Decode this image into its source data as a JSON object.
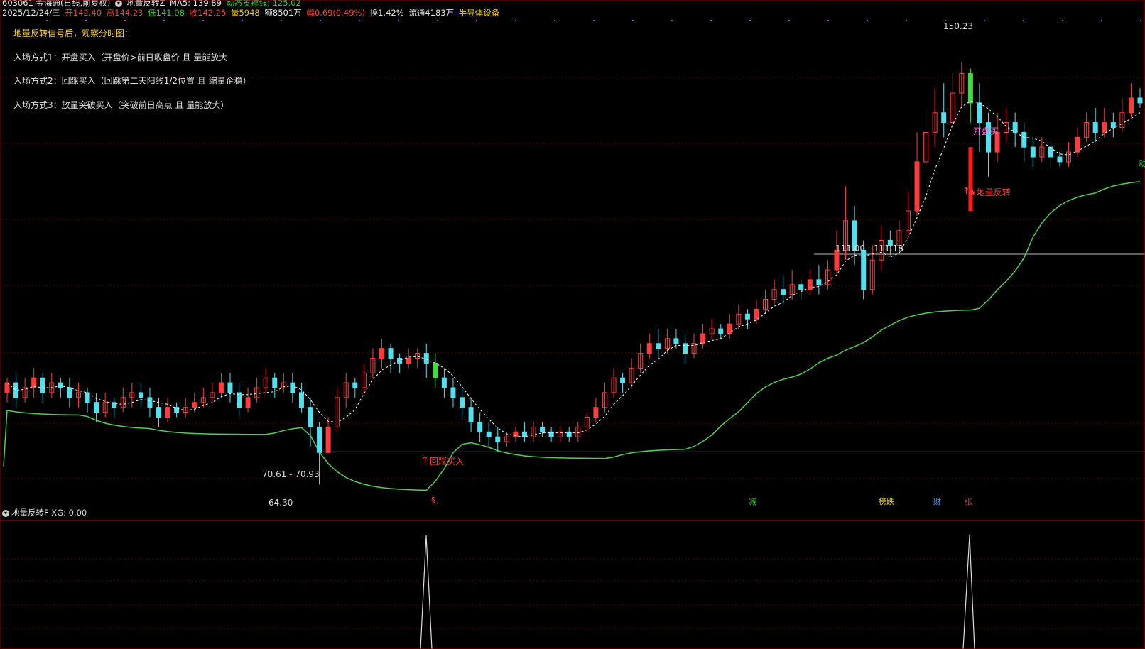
{
  "header": {
    "stock": "603061 金海通(日线,前复权)",
    "indicator": "地量反转Z",
    "ma5": "MA5: 139.89",
    "support": "动态支撑线: 125.02",
    "date": "2025/12/24/三",
    "open": "开142.40",
    "high": "高144.23",
    "low": "低141.08",
    "close": "收142.25",
    "vol": "量5948",
    "amount": "额8501万",
    "change": "幅0.69(0.49%)",
    "turnover": "换1.42%",
    "float": "流通4183万",
    "sector": "半导体设备"
  },
  "tips": {
    "title": "地量反转信号后，观察分时图：",
    "line1": "入场方式1：开盘买入（开盘价>前日收盘价 且 量能放大",
    "line2": "入场方式2：回踩买入（回踩第二天阳线1/2位置 且 缩量企稳）",
    "line3": "入场方式3：放量突破买入（突破前日高点 且 量能放大）"
  },
  "annotations": {
    "high_label": "150.23",
    "low_label": "64.30",
    "zone1": "70.61 - 70.93",
    "zone2": "111.00 - 111.18",
    "sig_pullback": "回踩买入",
    "sig_open": "开盘买",
    "sig_reverse": "★地量反转",
    "edge_label": "动"
  },
  "events": [
    {
      "label": "§",
      "color": "#ff3b3b"
    },
    {
      "label": "减",
      "color": "#2ecc40"
    },
    {
      "label": "榜跌",
      "color": "#f5d000"
    },
    {
      "label": "财",
      "color": "#4aa3ff"
    },
    {
      "label": "张",
      "color": "#ff3b3b"
    }
  ],
  "sub": {
    "title": "地量反转F",
    "xg": "XG: 0.00"
  },
  "colors": {
    "up": "#ff3b3b",
    "down": "#52e0ee",
    "signal": "#38e038",
    "support": "#4fd14f",
    "ma5": "#ffffff",
    "grid": "#5a0000"
  },
  "chart_data": {
    "type": "candlestick",
    "ylim": [
      60,
      155
    ],
    "key_prices": {
      "peak": 150.23,
      "bottom": 64.3,
      "zone1_low": 70.61,
      "zone1_high": 70.93,
      "zone2_low": 111.0,
      "zone2_high": 111.18
    },
    "candles": [
      [
        83,
        85,
        81,
        86
      ],
      [
        85,
        82,
        80,
        87
      ],
      [
        82,
        84,
        81,
        86
      ],
      [
        84,
        86,
        82,
        88
      ],
      [
        86,
        83,
        81,
        87
      ],
      [
        83,
        85,
        82,
        87
      ],
      [
        85,
        84,
        82,
        86
      ],
      [
        84,
        82,
        80,
        86
      ],
      [
        82,
        83,
        80,
        85
      ],
      [
        83,
        81,
        79,
        84
      ],
      [
        81,
        79,
        77,
        83
      ],
      [
        79,
        81,
        78,
        83
      ],
      [
        81,
        80,
        78,
        82
      ],
      [
        80,
        82,
        79,
        84
      ],
      [
        82,
        83,
        80,
        85
      ],
      [
        83,
        82,
        80,
        85
      ],
      [
        82,
        80,
        78,
        84
      ],
      [
        80,
        78,
        76,
        82
      ],
      [
        78,
        80,
        77,
        82
      ],
      [
        80,
        79,
        78,
        81
      ],
      [
        79,
        80,
        78,
        82
      ],
      [
        80,
        81,
        79,
        83
      ],
      [
        81,
        82,
        80,
        84
      ],
      [
        82,
        83,
        81,
        85
      ],
      [
        83,
        85,
        82,
        87
      ],
      [
        85,
        83,
        81,
        87
      ],
      [
        83,
        80,
        78,
        85
      ],
      [
        80,
        82,
        79,
        84
      ],
      [
        82,
        84,
        81,
        86
      ],
      [
        84,
        86,
        83,
        88
      ],
      [
        86,
        84,
        82,
        87
      ],
      [
        84,
        85,
        83,
        87
      ],
      [
        85,
        83,
        81,
        87
      ],
      [
        83,
        80,
        79,
        85
      ],
      [
        80,
        76,
        72,
        82
      ],
      [
        76,
        70.8,
        64.3,
        77
      ],
      [
        70.8,
        76,
        70.6,
        78
      ],
      [
        76,
        82,
        75,
        84
      ],
      [
        82,
        85,
        80,
        87
      ],
      [
        85,
        84,
        82,
        86
      ],
      [
        84,
        87,
        83,
        89
      ],
      [
        87,
        90,
        86,
        92
      ],
      [
        90,
        92,
        88,
        94
      ],
      [
        92,
        90,
        87,
        93
      ],
      [
        90,
        89,
        87,
        91
      ],
      [
        89,
        90,
        88,
        92
      ],
      [
        90,
        91,
        88,
        92
      ],
      [
        91,
        89,
        86,
        93
      ],
      [
        89,
        86,
        84,
        91
      ],
      [
        86,
        84,
        82,
        88
      ],
      [
        84,
        82,
        80,
        86
      ],
      [
        82,
        80,
        78,
        84
      ],
      [
        80,
        77,
        75,
        82
      ],
      [
        77,
        75,
        73,
        79
      ],
      [
        75,
        74,
        72,
        77
      ],
      [
        74,
        73,
        71,
        76
      ],
      [
        73,
        74,
        72,
        75
      ],
      [
        74,
        75,
        73,
        76
      ],
      [
        75,
        74,
        73,
        77
      ],
      [
        74,
        76,
        73,
        77
      ],
      [
        76,
        75,
        74,
        77
      ],
      [
        75,
        74,
        73,
        76
      ],
      [
        74,
        75,
        73,
        76
      ],
      [
        75,
        74,
        73,
        76
      ],
      [
        74,
        76,
        73,
        77
      ],
      [
        76,
        78,
        75,
        79
      ],
      [
        78,
        80,
        77,
        82
      ],
      [
        80,
        83,
        79,
        85
      ],
      [
        83,
        86,
        82,
        88
      ],
      [
        86,
        85,
        83,
        87
      ],
      [
        85,
        88,
        84,
        90
      ],
      [
        88,
        91,
        87,
        93
      ],
      [
        91,
        93,
        90,
        95
      ],
      [
        93,
        92,
        90,
        96
      ],
      [
        92,
        94,
        91,
        96
      ],
      [
        94,
        93,
        92,
        96
      ],
      [
        93,
        91,
        89,
        95
      ],
      [
        91,
        93,
        90,
        95
      ],
      [
        93,
        95,
        92,
        97
      ],
      [
        95,
        96,
        94,
        98
      ],
      [
        96,
        95,
        94,
        97
      ],
      [
        95,
        97,
        94,
        99
      ],
      [
        97,
        99,
        96,
        101
      ],
      [
        99,
        98,
        96,
        100
      ],
      [
        98,
        100,
        97,
        102
      ],
      [
        100,
        102,
        99,
        104
      ],
      [
        102,
        104,
        101,
        106
      ],
      [
        104,
        103,
        101,
        107
      ],
      [
        103,
        105,
        102,
        108
      ],
      [
        105,
        104,
        102,
        106
      ],
      [
        104,
        106,
        103,
        108
      ],
      [
        106,
        105,
        103,
        109
      ],
      [
        105,
        108,
        104,
        110
      ],
      [
        108,
        112,
        107,
        116
      ],
      [
        112,
        118,
        110,
        125
      ],
      [
        118,
        112,
        109,
        121
      ],
      [
        112,
        104,
        102,
        114
      ],
      [
        104,
        110,
        103,
        113
      ],
      [
        110,
        114,
        108,
        117
      ],
      [
        114,
        113,
        111,
        116
      ],
      [
        113,
        116,
        112,
        118
      ],
      [
        116,
        120,
        115,
        124
      ],
      [
        120,
        130,
        119,
        136
      ],
      [
        130,
        136,
        128,
        141
      ],
      [
        136,
        140,
        133,
        145
      ],
      [
        140,
        138,
        135,
        146
      ],
      [
        138,
        144,
        137,
        148
      ],
      [
        144,
        148,
        141,
        150.23
      ],
      [
        148,
        142,
        138,
        149
      ],
      [
        142,
        138,
        132,
        146
      ],
      [
        138,
        132,
        127,
        140
      ],
      [
        132,
        136,
        130,
        140
      ],
      [
        136,
        138,
        134,
        141
      ],
      [
        138,
        136,
        133,
        140
      ],
      [
        136,
        133,
        130,
        138
      ],
      [
        133,
        131,
        129,
        135
      ],
      [
        131,
        133,
        130,
        135
      ],
      [
        133,
        131,
        129,
        134
      ],
      [
        131,
        130,
        129,
        132
      ],
      [
        130,
        132,
        129,
        134
      ],
      [
        132,
        135,
        131,
        137
      ],
      [
        135,
        138,
        134,
        140
      ],
      [
        138,
        136,
        134,
        141
      ],
      [
        136,
        138,
        135,
        141
      ],
      [
        138,
        137,
        135,
        140
      ],
      [
        137,
        140,
        136,
        143
      ],
      [
        140,
        143,
        139,
        146
      ],
      [
        143,
        142,
        141,
        145
      ]
    ]
  }
}
